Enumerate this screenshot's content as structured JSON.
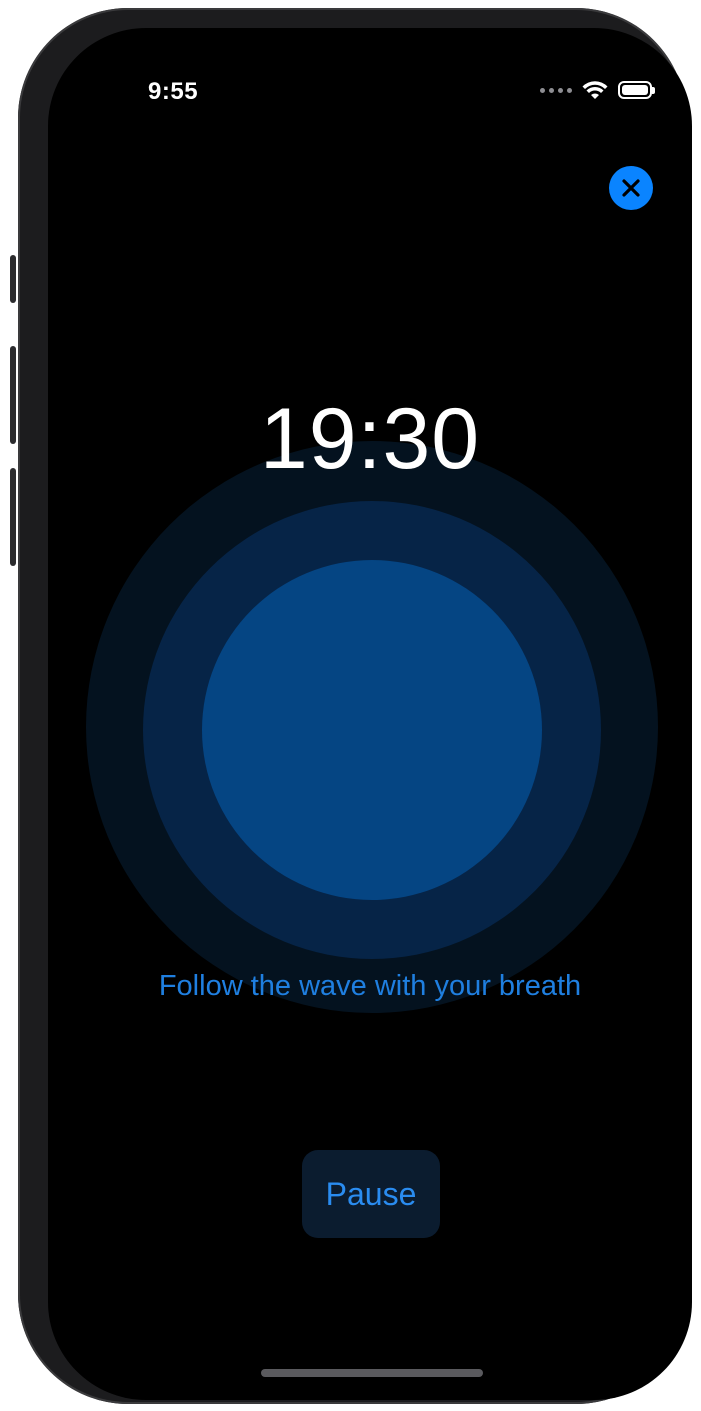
{
  "status_bar": {
    "time": "9:55"
  },
  "session": {
    "timer": "19:30",
    "instruction": "Follow the wave with your breath",
    "pause_label": "Pause"
  },
  "icons": {
    "close": "close-icon",
    "wifi": "wifi-icon",
    "battery": "battery-icon",
    "signal": "cellular-signal-icon"
  },
  "colors": {
    "accent": "#0a84ff",
    "caption": "#1f7fe0",
    "circle_outer": "#04121f",
    "circle_middle": "#062447",
    "circle_inner": "#054583",
    "background": "#000000"
  }
}
